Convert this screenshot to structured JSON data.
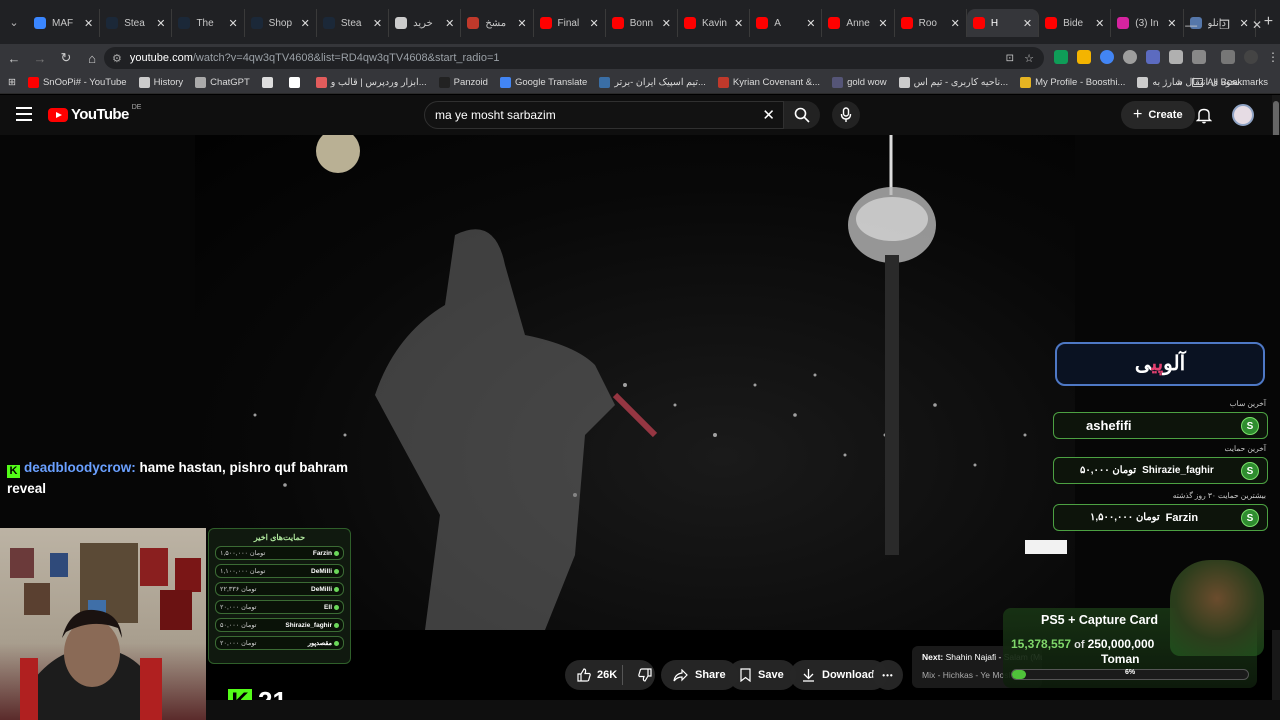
{
  "tabs": [
    {
      "label": "MAF",
      "color": "#3a86ff"
    },
    {
      "label": "Stea",
      "color": "#1b2838"
    },
    {
      "label": "The",
      "color": "#1b2838"
    },
    {
      "label": "Shop",
      "color": "#1b2838"
    },
    {
      "label": "Stea",
      "color": "#1b2838"
    },
    {
      "label": "خرید",
      "color": "#cccccc"
    },
    {
      "label": "مشخ",
      "color": "#c0392b"
    },
    {
      "label": "Final",
      "color": "#ff0000"
    },
    {
      "label": "Bonn",
      "color": "#ff0000"
    },
    {
      "label": "Kavin",
      "color": "#ff0000"
    },
    {
      "label": "A",
      "color": "#ff0000"
    },
    {
      "label": "Anne",
      "color": "#ff0000"
    },
    {
      "label": "Roo",
      "color": "#ff0000"
    },
    {
      "label": "H",
      "color": "#ff0000"
    },
    {
      "label": "Bide",
      "color": "#ff0000"
    },
    {
      "label": "(3) In",
      "color": "#d6249f"
    },
    {
      "label": "دانلو",
      "color": "#5577aa"
    }
  ],
  "omnibox": {
    "host": "youtube.com",
    "path": "/watch?v=4qw3qTV4608&list=RD4qw3qTV4608&start_radio=1"
  },
  "bookmarks": [
    {
      "label": "SnOoPi# - YouTube",
      "color": "#ff0000"
    },
    {
      "label": "History",
      "color": "#cccccc"
    },
    {
      "label": "ChatGPT",
      "color": "#aaaaaa"
    },
    {
      "label": "",
      "color": "#dddddd"
    },
    {
      "label": "",
      "color": "#ffffff"
    },
    {
      "label": "ابزار وردپرس | قالب و...",
      "color": "#e25c5c"
    },
    {
      "label": "Panzoid",
      "color": "#222222"
    },
    {
      "label": "Google Translate",
      "color": "#4285f4"
    },
    {
      "label": "تیم اسپیک ایران -برتر...",
      "color": "#3a6ea5"
    },
    {
      "label": "Kyrian Covenant &...",
      "color": "#c0392b"
    },
    {
      "label": "gold wow",
      "color": "#555577"
    },
    {
      "label": "ناحیه کاربری - تیم اس...",
      "color": "#cccccc"
    },
    {
      "label": "My Profile - Boosthi...",
      "color": "#e6b422"
    },
    {
      "label": "نحوه ی انتقال شارژ به...",
      "color": "#cccccc"
    }
  ],
  "bookmarks_all": "All Bookmarks",
  "youtube": {
    "region": "DE",
    "search_query": "ma ye mosht sarbazim",
    "create_label": "Create"
  },
  "overlay": {
    "chat_user": "deadbloodycrow:",
    "chat_text": " hame hastan, pishro quf bahram reveal",
    "recent_title": "حمایت‌های اخیر",
    "recent": [
      {
        "name": "Farzin",
        "amount": "۱,۵۰۰,۰۰۰ تومان"
      },
      {
        "name": "DeMilli",
        "amount": "۱,۱۰۰,۰۰۰ تومان"
      },
      {
        "name": "DeMilli",
        "amount": "۲۲,۳۳۶ تومان"
      },
      {
        "name": "Ell",
        "amount": "۲۰,۰۰۰ تومان"
      },
      {
        "name": "Shirazie_faghir",
        "amount": "۵۰,۰۰۰ تومان"
      },
      {
        "name": "مقصدپور",
        "amount": "۲۰,۰۰۰ تومان"
      }
    ],
    "kick_count": "21",
    "alopay_main": "آلو",
    "alopay_pi": "پی",
    "alopay_extra": "ی",
    "last_sub_label": "آخرین ساب",
    "last_sub_name": "ashefifi",
    "last_support_label": "آخرین حمایت",
    "last_support_name": "Shirazie_faghir",
    "last_support_amount": "۵۰,۰۰۰ تومان",
    "top_support_label": "بیشترین حمایت ۳۰ روز گذشته",
    "top_support_name": "Farzin",
    "top_support_amount": "۱,۵۰۰,۰۰۰ تومان",
    "badge_letter": "S",
    "goal_title": "PS5 + Capture Card",
    "goal_current": "15,378,557",
    "goal_of": " of ",
    "goal_target": "250,000,000",
    "goal_unit": "Toman",
    "goal_percent_label": "6%",
    "goal_progress": 0.06
  },
  "actions": {
    "likes": "26K",
    "share": "Share",
    "save": "Save",
    "download": "Download",
    "more": "•••"
  },
  "up_next": {
    "prefix": "Next:",
    "title": "Shahin Najafi - Salam (Music Video)",
    "mix": "Mix - Hichkas - Ye Mosht Sarbazim"
  }
}
